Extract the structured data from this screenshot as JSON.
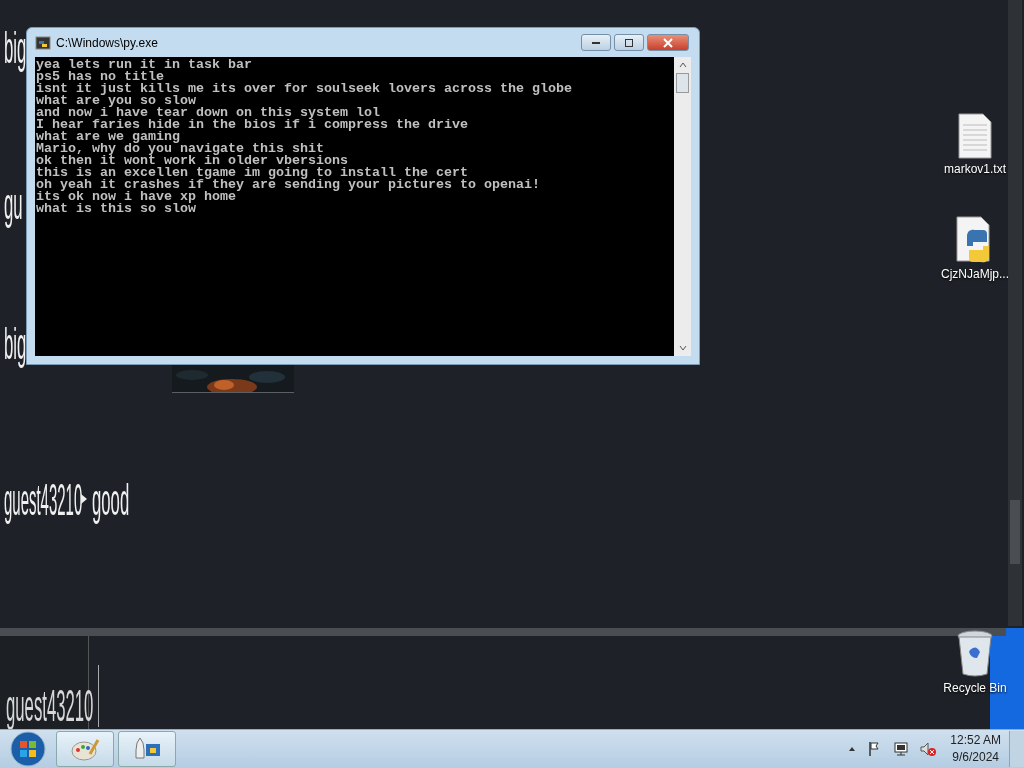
{
  "stream_overlay": {
    "fragments": [
      {
        "text": "big"
      },
      {
        "text": "gu"
      },
      {
        "text": "big"
      }
    ],
    "message": {
      "user": "guest43210",
      "text": "good"
    },
    "input_user": "guest43210"
  },
  "console_window": {
    "title": "C:\\Windows\\py.exe",
    "lines": [
      "yea lets run it in task bar",
      "ps5 has no title",
      "isnt it just kills me its over for soulseek lovers across the globe",
      "what are you so slow",
      "and now i have tear down on this system lol",
      "I hear faries hide in the bios if i compress the drive",
      "what are we gaming",
      "Mario, why do you navigate this shit",
      "ok then it wont work in older vbersions",
      "this is an excellen tgame im going to install the cert",
      "oh yeah it crashes if they are sending your pictures to openai!",
      "its ok now i have xp home",
      "what is this so slow"
    ]
  },
  "desktop_icons": [
    {
      "label": "markov1.txt",
      "kind": "text"
    },
    {
      "label": "CjzNJaMjp...",
      "kind": "python"
    },
    {
      "label": "Recycle Bin",
      "kind": "recycle"
    }
  ],
  "taskbar": {
    "pinned": [
      {
        "kind": "paint"
      },
      {
        "kind": "python"
      }
    ],
    "volume_muted": true,
    "time": "12:52 AM",
    "date": "9/6/2024"
  }
}
